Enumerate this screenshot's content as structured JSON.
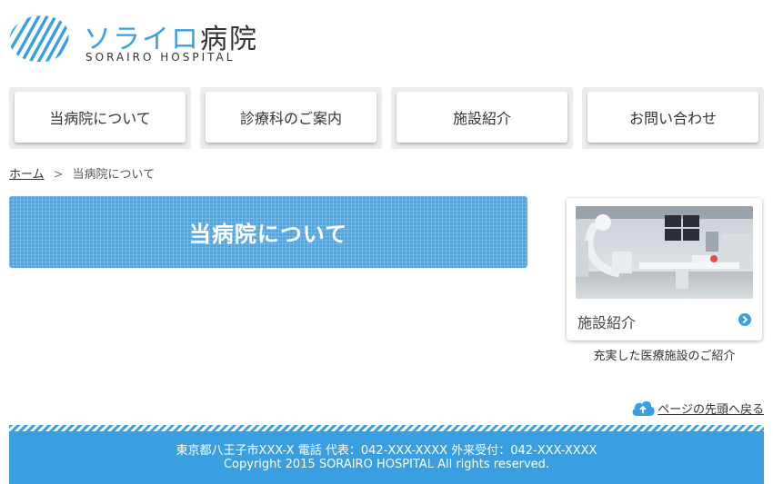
{
  "logo": {
    "title_kana": "ソライロ",
    "title_kanji": "病院",
    "subtitle": "SORAIRO HOSPITAL",
    "brand_color": "#3a9fe0",
    "icon": "striped-circle-logo"
  },
  "nav": {
    "items": [
      {
        "label": "当病院について"
      },
      {
        "label": "診療科のご案内"
      },
      {
        "label": "施設紹介"
      },
      {
        "label": "お問い合わせ"
      }
    ]
  },
  "breadcrumb": {
    "home": "ホーム",
    "separator": ">",
    "current": "当病院について"
  },
  "page_title": "当病院について",
  "side_banner": {
    "label": "施設紹介",
    "caption": "充実した医療施設のご紹介",
    "icon": "arrow-circle-icon",
    "image": "medical-equipment-room-photo"
  },
  "pagetop": {
    "label": "ページの先頭へ戻る",
    "icon": "cloud-up-arrow-icon"
  },
  "footer": {
    "address": "東京都八王子市XXX-X 電話 代表：042-XXX-XXXX 外来受付：042-XXX-XXXX",
    "copyright": "Copyright 2015 SORAIRO HOSPITAL All rights reserved.",
    "color": "#3a9fe0"
  }
}
